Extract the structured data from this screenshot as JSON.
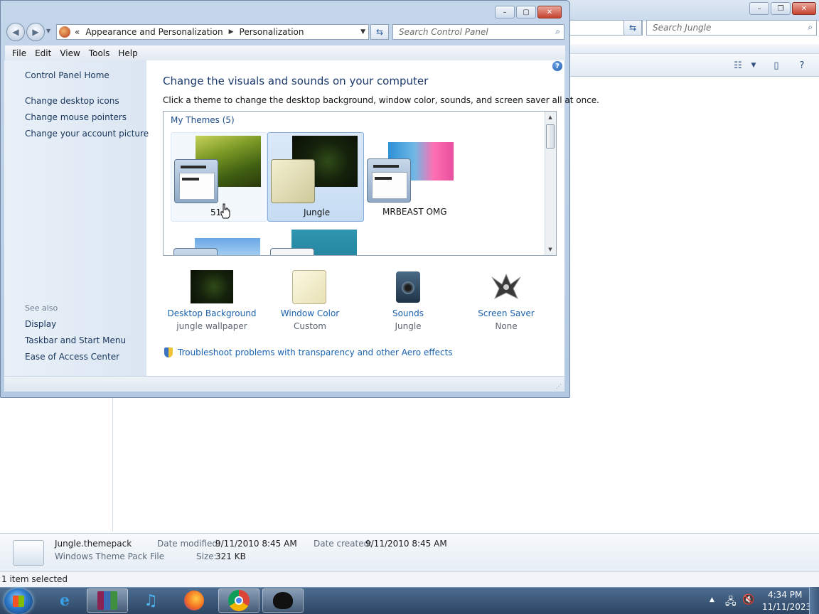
{
  "background_window": {
    "search_placeholder": "Search Jungle",
    "details": {
      "file_name": "Jungle.themepack",
      "file_type": "Windows Theme Pack File",
      "date_modified_label": "Date modified:",
      "date_modified": "9/11/2010 8:45 AM",
      "size_label": "Size:",
      "size": "321 KB",
      "date_created_label": "Date created:",
      "date_created": "9/11/2010 8:45 AM"
    },
    "status": "1 item selected"
  },
  "window": {
    "breadcrumb": {
      "overflow": "«",
      "parent": "Appearance and Personalization",
      "current": "Personalization"
    },
    "search_placeholder": "Search Control Panel",
    "menu": [
      "File",
      "Edit",
      "View",
      "Tools",
      "Help"
    ]
  },
  "sidebar": {
    "home": "Control Panel Home",
    "links": [
      "Change desktop icons",
      "Change mouse pointers",
      "Change your account picture"
    ],
    "see_also_heading": "See also",
    "see_also": [
      "Display",
      "Taskbar and Start Menu",
      "Ease of Access Center"
    ]
  },
  "main": {
    "heading": "Change the visuals and sounds on your computer",
    "subheading": "Click a theme to change the desktop background, window color, sounds, and screen saver all at once.",
    "group_label": "My Themes (5)",
    "themes": [
      {
        "label": "51",
        "state": "hover"
      },
      {
        "label": "Jungle",
        "state": "selected"
      },
      {
        "label": "MRBEAST OMG",
        "state": "normal"
      }
    ],
    "options": [
      {
        "title": "Desktop Background",
        "value": "jungle wallpaper"
      },
      {
        "title": "Window Color",
        "value": "Custom"
      },
      {
        "title": "Sounds",
        "value": "Jungle"
      },
      {
        "title": "Screen Saver",
        "value": "None"
      }
    ],
    "troubleshoot_link": "Troubleshoot problems with transparency and other Aero effects"
  },
  "taskbar": {
    "apps": [
      "internet-explorer",
      "winrar",
      "itunes",
      "firefox",
      "chrome",
      "ink-app"
    ],
    "active_app": "chrome",
    "time": "4:34 PM",
    "date": "11/11/2023"
  },
  "colors": {
    "link": "#1a62ae",
    "heading": "#1c3a6b",
    "selected_tile": "#c6dcf3"
  }
}
